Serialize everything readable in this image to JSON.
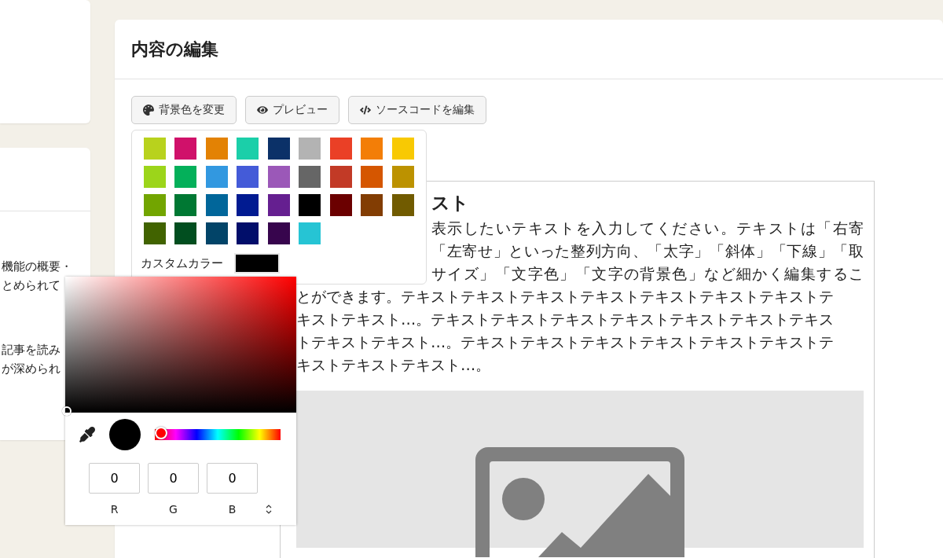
{
  "left_panel": {
    "paragraphs": [
      [
        "機能の概要・",
        "とめられて"
      ],
      [
        "記事を読み",
        "が深められ"
      ]
    ]
  },
  "editor": {
    "title": "内容の編集",
    "toolbar": [
      {
        "kind": "palette",
        "label": "背景色を変更"
      },
      {
        "kind": "preview",
        "label": "プレビュー"
      },
      {
        "kind": "code",
        "label": "ソースコードを編集"
      }
    ],
    "content": {
      "heading": "スト",
      "covered_lines": [
        "表示したいテキストを入力してください。テキストは「右寄",
        "「左寄せ」といった整列方向、「太字」「斜体」「下線」「取",
        "サイズ」「文字色」「文字の背景色」など細かく編集するこ"
      ],
      "lines": [
        "とができます。テキストテキストテキストテキストテキストテキストテキストテ",
        "キストテキスト…。テキストテキストテキストテキストテキストテキストテキス",
        "トテキストテキスト…。テキストテキストテキストテキストテキストテキストテ",
        "キストテキストテキスト…。"
      ],
      "image": {
        "kind": "placeholder"
      }
    }
  },
  "swatches": [
    {
      "color": "#b8d21d"
    },
    {
      "color": "#d0116a"
    },
    {
      "color": "#e38204"
    },
    {
      "color": "#1bcfa9"
    },
    {
      "color": "#0b3168"
    },
    {
      "color": "#b3b3b3"
    },
    {
      "color": "#ea4026"
    },
    {
      "color": "#f37e07"
    },
    {
      "color": "#f8c903"
    },
    {
      "color": "#9cd51a"
    },
    {
      "color": "#04b05a"
    },
    {
      "color": "#3298e0"
    },
    {
      "color": "#445bd8"
    },
    {
      "color": "#9b58b8"
    },
    {
      "color": "#666666"
    },
    {
      "color": "#c23a26"
    },
    {
      "color": "#d55600"
    },
    {
      "color": "#bc9200"
    },
    {
      "color": "#72a500"
    },
    {
      "color": "#007833"
    },
    {
      "color": "#01669a"
    },
    {
      "color": "#011b91"
    },
    {
      "color": "#651f90"
    },
    {
      "color": "#000000"
    },
    {
      "color": "#6b0000"
    },
    {
      "color": "#823d03"
    },
    {
      "color": "#715b00"
    },
    {
      "color": "#416300"
    },
    {
      "color": "#014e1f"
    },
    {
      "color": "#024468"
    },
    {
      "color": "#010e6a"
    },
    {
      "color": "#37054d"
    },
    {
      "color": "#26c4d4"
    }
  ],
  "custom_color": {
    "label": "カスタムカラー",
    "color": "#000000"
  },
  "picker": {
    "hue": {
      "level": 0
    },
    "channels": [
      {
        "label": "R",
        "value": "0"
      },
      {
        "label": "G",
        "value": "0"
      },
      {
        "label": "B",
        "value": "0"
      }
    ]
  }
}
